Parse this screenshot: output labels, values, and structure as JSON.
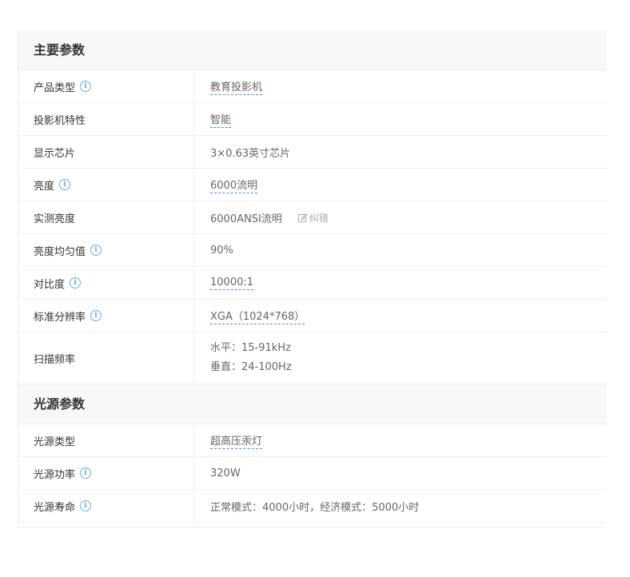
{
  "sections": [
    {
      "title": "主要参数",
      "rows": [
        {
          "name": "产品类型",
          "value": "教育投影机"
        },
        {
          "name": "投影机特性",
          "value": "智能"
        },
        {
          "name": "显示芯片",
          "value": "3×0.63英寸芯片"
        },
        {
          "name": "亮度",
          "value": "6000流明"
        },
        {
          "name": "实测亮度",
          "value": "6000ANSI流明",
          "action": "纠错"
        },
        {
          "name": "亮度均匀值",
          "value": "90%"
        },
        {
          "name": "对比度",
          "value": "10000:1"
        },
        {
          "name": "标准分辨率",
          "value": "XGA（1024*768）"
        },
        {
          "name": "扫描频率",
          "value_line1": "水平：15-91kHz",
          "value_line2": "垂直：24-100Hz"
        }
      ]
    },
    {
      "title": "光源参数",
      "rows": [
        {
          "name": "光源类型",
          "value": "超高压汞灯"
        },
        {
          "name": "光源功率",
          "value": "320W"
        },
        {
          "name": "光源寿命",
          "value": "正常模式：4000小时，经济模式：5000小时"
        }
      ]
    }
  ],
  "info_icon_glyph": "i",
  "colors": {
    "link_underline": "#4a8fd6",
    "info_icon": "#6aaae0",
    "section_bg": "#f8f8f8"
  }
}
